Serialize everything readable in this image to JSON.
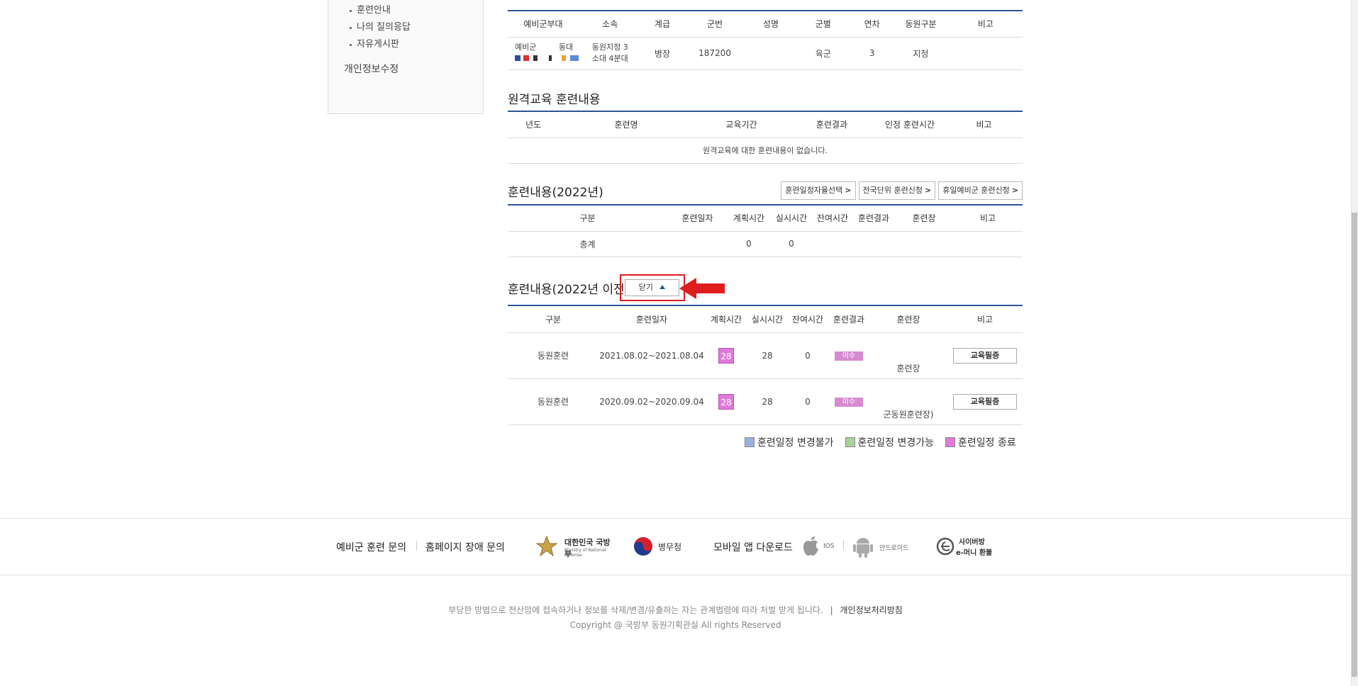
{
  "sidebar": {
    "items": [
      "훈련안내",
      "나의 질의응답",
      "자유게시판"
    ],
    "privacy_edit": "개인정보수정"
  },
  "unit_table": {
    "headers": [
      "예비군부대",
      "소속",
      "계급",
      "군번",
      "성명",
      "군별",
      "연차",
      "동원구분",
      "비고"
    ],
    "row": {
      "unit_line1": "예비군",
      "unit_line1b": "동대",
      "affil_line1": "동원지정 3",
      "affil_line2": "소대 4분대",
      "rank": "병장",
      "service_no": "187200",
      "name": "",
      "branch": "육군",
      "year": "3",
      "mob_type": "지정",
      "note": ""
    }
  },
  "remote": {
    "title": "원격교육 훈련내용",
    "headers": [
      "년도",
      "훈련명",
      "교육기간",
      "훈련결과",
      "인정 훈련시간",
      "비고"
    ],
    "empty_msg": "원격교육에 대한 훈련내용이 없습니다."
  },
  "training2022": {
    "title": "훈련내용(2022년)",
    "buttons": [
      "훈련일정자율선택",
      "전국단위 훈련신청",
      "휴일예비군 훈련신청"
    ],
    "chevron": ">",
    "headers": [
      "구분",
      "훈련일자",
      "계획시간",
      "실시시간",
      "잔여시간",
      "훈련결과",
      "훈련장",
      "비고"
    ],
    "total_row": {
      "label": "총계",
      "planned": "0",
      "actual": "0"
    }
  },
  "training_prev": {
    "title": "훈련내용(2022년 이전)",
    "close_button": "닫기",
    "headers": [
      "구분",
      "훈련일자",
      "계획시간",
      "실시시간",
      "잔여시간",
      "훈련결과",
      "훈련장",
      "비고"
    ],
    "rows": [
      {
        "type": "동원훈련",
        "dates": "2021.08.02~2021.08.04",
        "planned": "28",
        "actual": "28",
        "remain": "0",
        "result": "이수",
        "place": "훈련장",
        "action": "교육필증"
      },
      {
        "type": "동원훈련",
        "dates": "2020.09.02~2020.09.04",
        "planned": "28",
        "actual": "28",
        "remain": "0",
        "result": "이수",
        "place": "군동원훈련장)",
        "action": "교육필증"
      }
    ]
  },
  "legend": [
    {
      "label": "훈련일정 변경불가",
      "color": "#9ab0de"
    },
    {
      "label": "훈련일정 변경가능",
      "color": "#a9d19a"
    },
    {
      "label": "훈련일정 종료",
      "color": "#e07ad8"
    }
  ],
  "footer": {
    "links": [
      "예비군 훈련 문의",
      "홈페이지 장애 문의"
    ],
    "mnd_name": "대한민국 국방부",
    "mnd_sub": "Ministry of National Defense",
    "mma_name": "병무청",
    "app_download": "모바일 앱 다운로드",
    "ios": "IOS",
    "android": "안드로이드",
    "cyber_line1": "사이버방",
    "cyber_line2": "e-머니 환불",
    "notice": "부당한 방법으로 전산망에 접속하거나 정보를 삭제/변경/유출하는 자는 관계법령에 따라 처벌 받게 됩니다.",
    "privacy_policy": "개인정보처리방침",
    "copyright": "Copyright @ 국방부 동원기획관실 All rights Reserved"
  },
  "colors": {
    "accent_line": "#2e5597",
    "highlight_red": "#e01d1d",
    "pink_badge": "#e07ad8"
  }
}
